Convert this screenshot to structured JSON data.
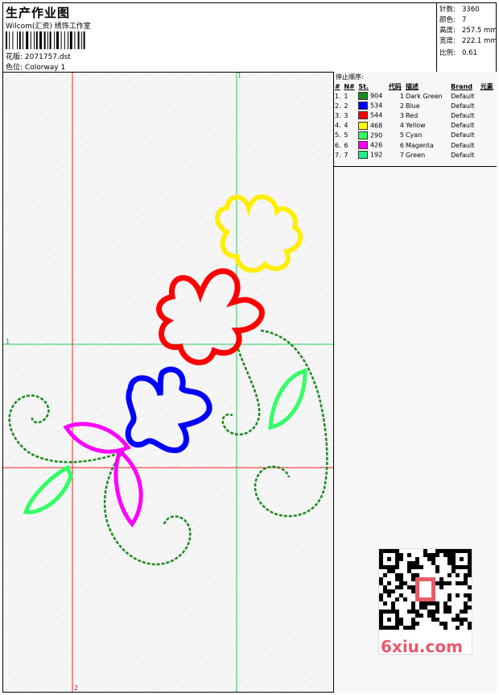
{
  "header": {
    "title": "生产作业图",
    "company": "Wilcom(汇资) 绣饰工作室",
    "design_label": "花版:",
    "design_value": "2071757.dst",
    "color_label": "色位:",
    "color_value": "Colorway 1"
  },
  "stats": {
    "stitches_label": "针数:",
    "stitches": "3360",
    "colors_label": "颜色:",
    "colors": "7",
    "height_label": "高度:",
    "height": "257.5 mm",
    "width_label": "宽度:",
    "width": "222.1 mm",
    "ratio_label": "比例:",
    "ratio": "0.61"
  },
  "panel": {
    "heading": "停止顺序:",
    "columns": [
      "#",
      "N#",
      "St.",
      "代码",
      "描述",
      "Brand",
      "元素"
    ],
    "rows": [
      {
        "idx": "1.",
        "n": "1",
        "st": "904",
        "code": "1",
        "desc": "Dark Green",
        "brand": "Default",
        "color": "#1a8a1a"
      },
      {
        "idx": "2.",
        "n": "2",
        "st": "534",
        "code": "2",
        "desc": "Blue",
        "brand": "Default",
        "color": "#0000ff"
      },
      {
        "idx": "3.",
        "n": "3",
        "st": "544",
        "code": "3",
        "desc": "Red",
        "brand": "Default",
        "color": "#ff0000"
      },
      {
        "idx": "4.",
        "n": "4",
        "st": "468",
        "code": "4",
        "desc": "Yellow",
        "brand": "Default",
        "color": "#ffff00"
      },
      {
        "idx": "5.",
        "n": "5",
        "st": "290",
        "code": "5",
        "desc": "Cyan",
        "brand": "Default",
        "color": "#33ff66"
      },
      {
        "idx": "6.",
        "n": "6",
        "st": "426",
        "code": "6",
        "desc": "Magenta",
        "brand": "Default",
        "color": "#ff00ff"
      },
      {
        "idx": "7.",
        "n": "7",
        "st": "192",
        "code": "7",
        "desc": "Green",
        "brand": "Default",
        "color": "#22ee88"
      }
    ]
  },
  "canvas": {
    "marker_top": "1",
    "marker_left": "1",
    "marker_bottom": "2",
    "guide_vertical_color": "#22cc55",
    "guide_red_color": "#ee2222"
  },
  "watermark": {
    "brand": "6xiu.com",
    "stamp": "刺绣图"
  }
}
